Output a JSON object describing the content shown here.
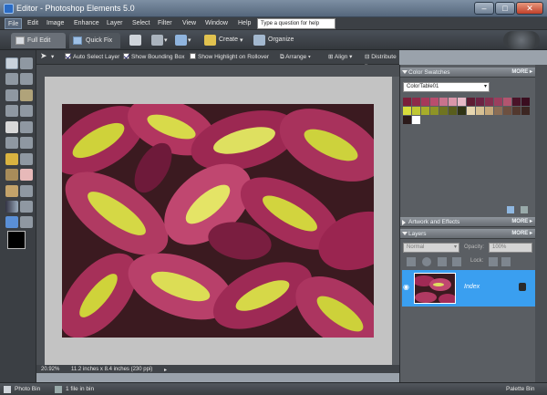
{
  "window": {
    "title": "Editor - Photoshop Elements 5.0"
  },
  "menubar": {
    "items": [
      "File",
      "Edit",
      "Image",
      "Enhance",
      "Layer",
      "Select",
      "Filter",
      "View",
      "Window",
      "Help"
    ],
    "help_placeholder": "Type a question for help"
  },
  "toolbar": {
    "full_edit": "Full Edit",
    "quick_fix": "Quick Fix",
    "create": "Create",
    "organize": "Organize"
  },
  "options": {
    "auto_select": "Auto Select Layer",
    "bounding_box": "Show Bounding Box",
    "highlight": "Show Highlight on Rollover",
    "arrange": "Arrange",
    "align": "Align",
    "distribute": "Distribute"
  },
  "document": {
    "zoom": "20.92%",
    "dimensions": "11.2 inches x 8.4 inches (230 ppi)"
  },
  "panels": {
    "swatches": {
      "title": "Color Swatches",
      "more": "MORE",
      "table": "ColorTable01",
      "colors": [
        "#7a1f3a",
        "#8e2a49",
        "#a6395a",
        "#b94d6d",
        "#c9738c",
        "#d996a9",
        "#e6b9c6",
        "#5e1c33",
        "#6b2343",
        "#84304f",
        "#9b3f5e",
        "#b2556f",
        "#4a1328",
        "#3a0d1f",
        "#d8dc3c",
        "#c0c732",
        "#a8ad2a",
        "#8e9426",
        "#6f7420",
        "#585d1c",
        "#2f3314",
        "#e7d6b0",
        "#d6c093",
        "#c5a87a",
        "#8a6d55",
        "#6d5040",
        "#52382e",
        "#3c2622",
        "#2b1a1a",
        "#ffffff"
      ]
    },
    "artwork": {
      "title": "Artwork and Effects",
      "more": "MORE"
    },
    "layers": {
      "title": "Layers",
      "more": "MORE",
      "blend": "Normal",
      "opacity_label": "Opacity:",
      "opacity": "100%",
      "lock_label": "Lock:",
      "layer_name": "Index"
    }
  },
  "statusbar": {
    "photo_bin": "Photo Bin",
    "file_count": "1 file in bin",
    "palette_bin": "Palette Bin"
  }
}
